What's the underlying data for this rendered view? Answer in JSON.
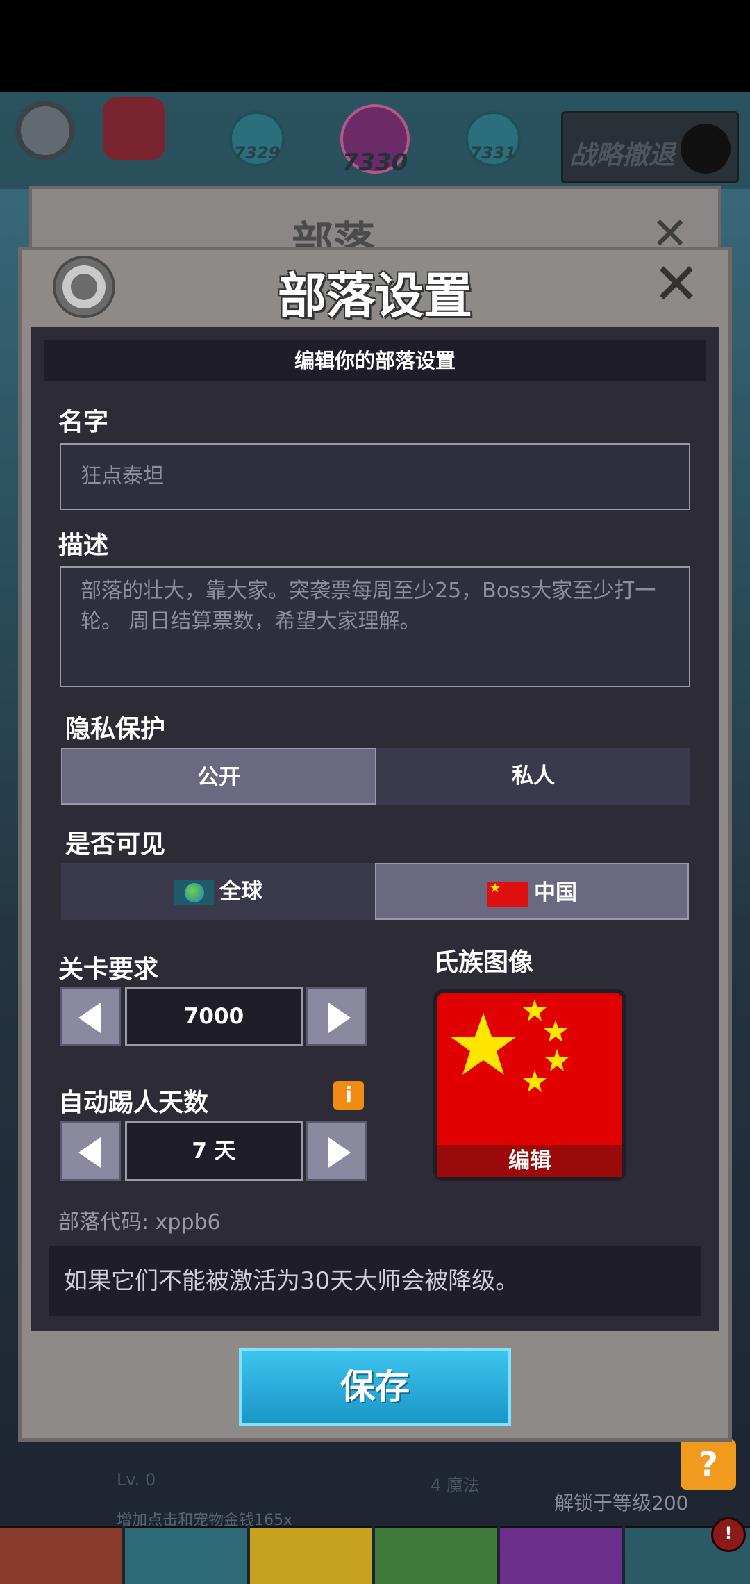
{
  "background": {
    "stages": [
      "7329",
      "7330",
      "7331"
    ],
    "retreat_label": "战略撤退",
    "back_dialog_title": "部落",
    "level_text": "Lv. 0",
    "damage_text": "增加点击和宠物金钱165x",
    "magic_text": "4 魔法",
    "unlock_text": "解锁于等级200",
    "help_label": "?",
    "notification_label": "!"
  },
  "dialog": {
    "title": "部落设置",
    "close_label": "✕",
    "subheader": "编辑你的部落设置",
    "name": {
      "label": "名字",
      "value": "狂点泰坦"
    },
    "description": {
      "label": "描述",
      "value": "部落的壮大，靠大家。突袭票每周至少25，Boss大家至少打一轮。 周日结算票数，希望大家理解。"
    },
    "privacy": {
      "label": "隐私保护",
      "options": [
        "公开",
        "私人"
      ],
      "selected": "公开"
    },
    "visibility": {
      "label": "是否可见",
      "options": [
        "全球",
        "中国"
      ],
      "selected": "中国"
    },
    "stage_requirement": {
      "label": "关卡要求",
      "value": "7000"
    },
    "auto_kick": {
      "label": "自动踢人天数",
      "value": "7 天",
      "info_label": "i"
    },
    "emblem": {
      "label": "氏族图像",
      "edit_label": "编辑",
      "color": "#e00000",
      "star_color": "#ffe600"
    },
    "clan_code": "部落代码: xppb6",
    "note": "如果它们不能被激活为30天大师会被降级。",
    "save_label": "保存"
  }
}
